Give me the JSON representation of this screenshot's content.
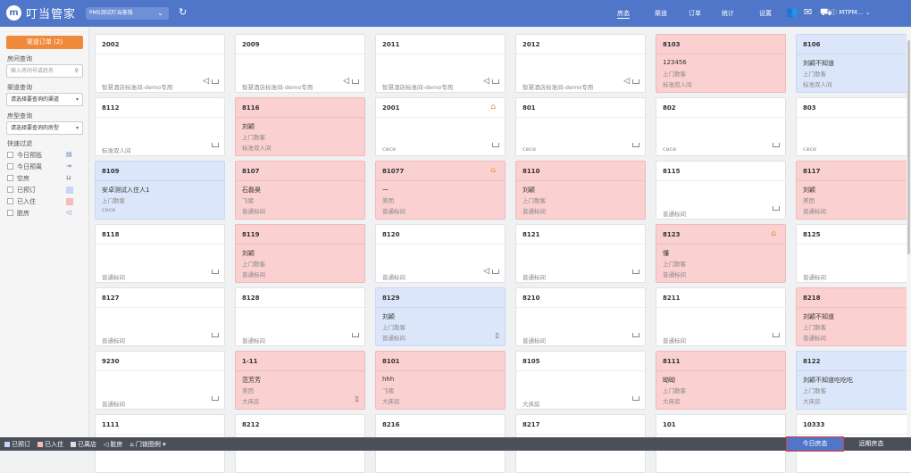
{
  "topbar": {
    "logo_letter": "m",
    "app_name": "叮当管家",
    "hotel_selector": "PMS测试叮当客栈",
    "refresh_icon": "↻",
    "nav": [
      "房态",
      "渠道",
      "订单",
      "统计",
      "设置"
    ],
    "active_nav": "房态",
    "user": "MTPM..."
  },
  "sidebar": {
    "channel_orders": "渠道订单 (2)",
    "room_query_label": "房间查询",
    "room_query_placeholder": "输入房间号或姓名",
    "channel_query_label": "渠道查询",
    "channel_select": "请选择要查询的渠道",
    "roomtype_query_label": "房型查询",
    "roomtype_select": "请选择要查询的房型",
    "quick_filter_label": "快速过滤",
    "filters": [
      {
        "label": "今日预抵",
        "icon": "arrive-icon"
      },
      {
        "label": "今日预离",
        "icon": "depart-icon"
      },
      {
        "label": "空房",
        "icon": "bed-icon"
      },
      {
        "label": "已预订",
        "icon": "booked-swatch"
      },
      {
        "label": "已入住",
        "icon": "checked-in-swatch"
      },
      {
        "label": "脏房",
        "icon": "dirty-icon"
      }
    ]
  },
  "colors": {
    "primary": "#4f76c8",
    "booked": "#dce6fa",
    "checked_in": "#fad0d0",
    "accent_orange": "#f08a3a",
    "highlight_red": "#e53935"
  },
  "rooms": [
    {
      "number": "2002",
      "status": "empty",
      "line1": "",
      "line2": "",
      "type": "智慧酒店标准间-demo专用",
      "dirty": true
    },
    {
      "number": "2009",
      "status": "empty",
      "line1": "",
      "line2": "",
      "type": "智慧酒店标准间-demo专用",
      "dirty": true
    },
    {
      "number": "2011",
      "status": "empty",
      "line1": "",
      "line2": "",
      "type": "智慧酒店标准间-demo专用",
      "dirty": true
    },
    {
      "number": "2012",
      "status": "empty",
      "line1": "",
      "line2": "",
      "type": "智慧酒店标准间-demo专用",
      "dirty": true
    },
    {
      "number": "8103",
      "status": "live",
      "line1": "123456",
      "line2": "上门散客",
      "type": "标准双人间"
    },
    {
      "number": "8106",
      "status": "book",
      "line1": "刘颖不知道",
      "line2": "上门散客",
      "type": "标准双人间",
      "door": true
    },
    {
      "number": "8112",
      "status": "empty",
      "line1": "",
      "line2": "",
      "type": "标准双人间"
    },
    {
      "number": "8116",
      "status": "live",
      "line1": "刘颖",
      "line2": "上门散客",
      "type": "标准双人间"
    },
    {
      "number": "2001",
      "status": "empty",
      "line1": "",
      "line2": "",
      "type": "cece",
      "lock": true
    },
    {
      "number": "801",
      "status": "empty",
      "line1": "",
      "line2": "",
      "type": "cece"
    },
    {
      "number": "802",
      "status": "empty",
      "line1": "",
      "line2": "",
      "type": "cece"
    },
    {
      "number": "803",
      "status": "empty",
      "line1": "",
      "line2": "",
      "type": "cece"
    },
    {
      "number": "8109",
      "status": "book",
      "line1": "安卓测试入住人1",
      "line2": "上门散客",
      "type": "cece"
    },
    {
      "number": "8107",
      "status": "live",
      "line1": "石磊昊",
      "line2": "飞猪",
      "type": "普通标间"
    },
    {
      "number": "81077",
      "status": "live",
      "line1": "一",
      "line2": "美团",
      "type": "普通标间",
      "lock": true
    },
    {
      "number": "8110",
      "status": "live",
      "line1": "刘颖",
      "line2": "上门散客",
      "type": "普通标间"
    },
    {
      "number": "8115",
      "status": "empty",
      "line1": "",
      "line2": "",
      "type": "普通标间"
    },
    {
      "number": "8117",
      "status": "live",
      "line1": "刘颖",
      "line2": "美团",
      "type": "普通标间"
    },
    {
      "number": "8118",
      "status": "empty",
      "line1": "",
      "line2": "",
      "type": "普通标间"
    },
    {
      "number": "8119",
      "status": "live",
      "line1": "刘颖",
      "line2": "上门散客",
      "type": "普通标间"
    },
    {
      "number": "8120",
      "status": "empty",
      "line1": "",
      "line2": "",
      "type": "普通标间",
      "dirty": true
    },
    {
      "number": "8121",
      "status": "empty",
      "line1": "",
      "line2": "",
      "type": "普通标间"
    },
    {
      "number": "8123",
      "status": "live",
      "line1": "懂",
      "line2": "上门散客",
      "type": "普通标间",
      "lock": true
    },
    {
      "number": "8125",
      "status": "empty",
      "line1": "",
      "line2": "",
      "type": "普通标间"
    },
    {
      "number": "8127",
      "status": "empty",
      "line1": "",
      "line2": "",
      "type": "普通标间"
    },
    {
      "number": "8128",
      "status": "empty",
      "line1": "",
      "line2": "",
      "type": "普通标间"
    },
    {
      "number": "8129",
      "status": "book",
      "line1": "刘颖",
      "line2": "上门散客",
      "type": "普通标间",
      "door": true
    },
    {
      "number": "8210",
      "status": "empty",
      "line1": "",
      "line2": "",
      "type": "普通标间"
    },
    {
      "number": "8211",
      "status": "empty",
      "line1": "",
      "line2": "",
      "type": "普通标间"
    },
    {
      "number": "8218",
      "status": "live",
      "line1": "刘颖不知道",
      "line2": "上门散客",
      "type": "普通标间"
    },
    {
      "number": "9230",
      "status": "empty",
      "line1": "",
      "line2": "",
      "type": "普通标间"
    },
    {
      "number": "1-11",
      "status": "live",
      "line1": "范芳芳",
      "line2": "美团",
      "type": "大床房",
      "door": true
    },
    {
      "number": "8101",
      "status": "live",
      "line1": "hhh",
      "line2": "飞猪",
      "type": "大床房"
    },
    {
      "number": "8105",
      "status": "empty",
      "line1": "",
      "line2": "",
      "type": "大床房"
    },
    {
      "number": "8111",
      "status": "live",
      "line1": "呦呦",
      "line2": "上门散客",
      "type": "大床房"
    },
    {
      "number": "8122",
      "status": "book",
      "line1": "刘颖不知道吃吃吃",
      "line2": "上门散客",
      "type": "大床房",
      "door": true
    },
    {
      "number": "1111",
      "status": "empty",
      "line1": "",
      "line2": "",
      "type": ""
    },
    {
      "number": "8212",
      "status": "empty",
      "line1": "",
      "line2": "",
      "type": ""
    },
    {
      "number": "8216",
      "status": "empty",
      "line1": "",
      "line2": "",
      "type": ""
    },
    {
      "number": "8217",
      "status": "empty",
      "line1": "",
      "line2": "",
      "type": ""
    },
    {
      "number": "101",
      "status": "empty",
      "line1": "",
      "line2": "",
      "type": ""
    },
    {
      "number": "10333",
      "status": "empty",
      "line1": "",
      "line2": "",
      "type": ""
    }
  ],
  "bottombar": {
    "legend": [
      "已预订",
      "已入住",
      "已离店",
      "脏房",
      "门锁图例"
    ],
    "today_button": "今日房态",
    "long_button": "远期房态"
  }
}
